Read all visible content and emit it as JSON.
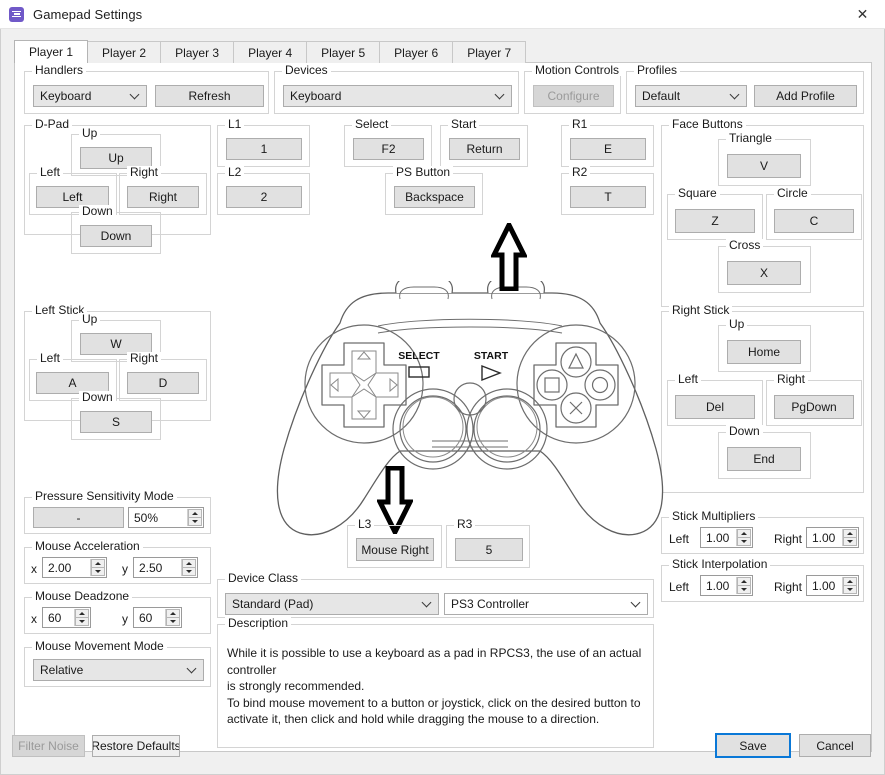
{
  "window": {
    "title": "Gamepad Settings",
    "icon": "app-window-icon",
    "close_label": "✕"
  },
  "tabs": [
    {
      "label": "Player 1",
      "active": true
    },
    {
      "label": "Player 2",
      "active": false
    },
    {
      "label": "Player 3",
      "active": false
    },
    {
      "label": "Player 4",
      "active": false
    },
    {
      "label": "Player 5",
      "active": false
    },
    {
      "label": "Player 6",
      "active": false
    },
    {
      "label": "Player 7",
      "active": false
    }
  ],
  "top": {
    "handlers": {
      "legend": "Handlers",
      "value": "Keyboard",
      "refresh_label": "Refresh"
    },
    "devices": {
      "legend": "Devices",
      "value": "Keyboard"
    },
    "motion": {
      "legend": "Motion Controls",
      "configure_label": "Configure",
      "disabled": true
    },
    "profiles": {
      "legend": "Profiles",
      "value": "Default",
      "add_label": "Add Profile"
    }
  },
  "dpad": {
    "legend": "D-Pad",
    "up": {
      "legend": "Up",
      "value": "Up"
    },
    "left": {
      "legend": "Left",
      "value": "Left"
    },
    "right": {
      "legend": "Right",
      "value": "Right"
    },
    "down": {
      "legend": "Down",
      "value": "Down"
    }
  },
  "left_stick": {
    "legend": "Left Stick",
    "up": {
      "legend": "Up",
      "value": "W"
    },
    "left": {
      "legend": "Left",
      "value": "A"
    },
    "right": {
      "legend": "Right",
      "value": "D"
    },
    "down": {
      "legend": "Down",
      "value": "S"
    }
  },
  "pressure": {
    "legend": "Pressure Sensitivity Mode",
    "button_value": "-",
    "percent_value": "50%"
  },
  "mouse_acceleration": {
    "legend": "Mouse Acceleration",
    "x_label": "x",
    "x_value": "2.00",
    "y_label": "y",
    "y_value": "2.50"
  },
  "mouse_deadzone": {
    "legend": "Mouse Deadzone",
    "x_label": "x",
    "x_value": "60",
    "y_label": "y",
    "y_value": "60"
  },
  "mouse_movement": {
    "legend": "Mouse Movement Mode",
    "value": "Relative"
  },
  "shoulders": {
    "l1": {
      "legend": "L1",
      "value": "1"
    },
    "l2": {
      "legend": "L2",
      "value": "2"
    },
    "r1": {
      "legend": "R1",
      "value": "E"
    },
    "r2": {
      "legend": "R2",
      "value": "T"
    },
    "l3": {
      "legend": "L3",
      "value": "Mouse Right"
    },
    "r3": {
      "legend": "R3",
      "value": "5"
    }
  },
  "center": {
    "select": {
      "legend": "Select",
      "value": "F2"
    },
    "start": {
      "legend": "Start",
      "value": "Return"
    },
    "ps_button": {
      "legend": "PS Button",
      "value": "Backspace"
    }
  },
  "face_buttons": {
    "legend": "Face Buttons",
    "triangle": {
      "legend": "Triangle",
      "value": "V"
    },
    "square": {
      "legend": "Square",
      "value": "Z"
    },
    "circle": {
      "legend": "Circle",
      "value": "C"
    },
    "cross": {
      "legend": "Cross",
      "value": "X"
    }
  },
  "right_stick": {
    "legend": "Right Stick",
    "up": {
      "legend": "Up",
      "value": "Home"
    },
    "left": {
      "legend": "Left",
      "value": "Del"
    },
    "right": {
      "legend": "Right",
      "value": "PgDown"
    },
    "down": {
      "legend": "Down",
      "value": "End"
    }
  },
  "stick_multipliers": {
    "legend": "Stick Multipliers",
    "left_label": "Left",
    "left_value": "1.00",
    "right_label": "Right",
    "right_value": "1.00"
  },
  "stick_interpolation": {
    "legend": "Stick Interpolation",
    "left_label": "Left",
    "left_value": "1.00",
    "right_label": "Right",
    "right_value": "1.00"
  },
  "device_class": {
    "legend": "Device Class",
    "class_value": "Standard (Pad)",
    "product_value": "PS3 Controller"
  },
  "description": {
    "legend": "Description",
    "line1": "While it is possible to use a keyboard as a pad in RPCS3, the use of an actual controller",
    "line2": "is strongly recommended.",
    "line3": "To bind mouse movement to a button or joystick, click on the desired button to",
    "line4": "activate it, then click and hold while dragging the mouse to a direction."
  },
  "footer": {
    "filter_noise_label": "Filter Noise",
    "restore_defaults_label": "Restore Defaults",
    "save_label": "Save",
    "cancel_label": "Cancel"
  },
  "controller_art": {
    "select_label": "SELECT",
    "start_label": "START",
    "arrow_up": "arrow-up-annotation",
    "arrow_down": "arrow-down-annotation"
  },
  "colors": {
    "accent": "#0a78d7",
    "window_bg": "#f0f0f0",
    "page_bg": "#ffffff",
    "button_bg": "#e1e1e1",
    "icon_purple": "#7059c8"
  }
}
